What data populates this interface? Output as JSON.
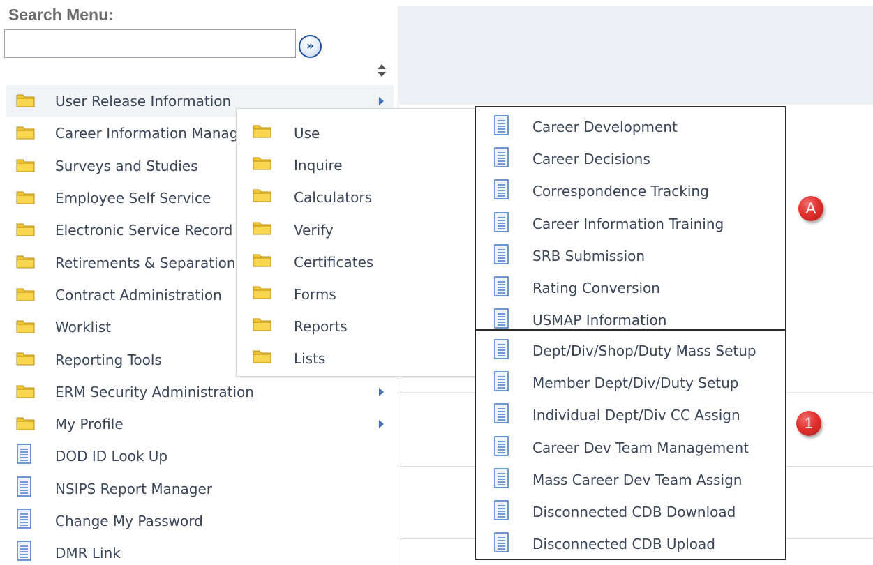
{
  "search": {
    "title": "Search Menu:",
    "value": "",
    "placeholder": "",
    "go_glyph": "»"
  },
  "menu": {
    "items": [
      {
        "label": "User Release Information",
        "type": "folder",
        "has_submenu": true,
        "active": true
      },
      {
        "label": "Career Information Management",
        "type": "folder"
      },
      {
        "label": "Surveys and Studies",
        "type": "folder"
      },
      {
        "label": "Employee Self Service",
        "type": "folder"
      },
      {
        "label": "Electronic Service Record",
        "type": "folder"
      },
      {
        "label": "Retirements & Separations",
        "type": "folder"
      },
      {
        "label": "Contract Administration",
        "type": "folder"
      },
      {
        "label": "Worklist",
        "type": "folder"
      },
      {
        "label": "Reporting Tools",
        "type": "folder"
      },
      {
        "label": "ERM Security Administration",
        "type": "folder",
        "has_submenu": true
      },
      {
        "label": "My Profile",
        "type": "folder",
        "has_submenu": true
      },
      {
        "label": "DOD ID Look Up",
        "type": "page"
      },
      {
        "label": "NSIPS Report Manager",
        "type": "page"
      },
      {
        "label": "Change My Password",
        "type": "page"
      },
      {
        "label": "DMR Link",
        "type": "page"
      }
    ]
  },
  "submenu": {
    "items": [
      {
        "label": "Use"
      },
      {
        "label": "Inquire"
      },
      {
        "label": "Calculators"
      },
      {
        "label": "Verify"
      },
      {
        "label": "Certificates"
      },
      {
        "label": "Forms"
      },
      {
        "label": "Reports"
      },
      {
        "label": "Lists"
      }
    ]
  },
  "group_a": {
    "callout": "A",
    "items": [
      {
        "label": "Career Development"
      },
      {
        "label": "Career Decisions"
      },
      {
        "label": "Correspondence Tracking"
      },
      {
        "label": "Career Information Training"
      },
      {
        "label": "SRB Submission"
      },
      {
        "label": "Rating Conversion"
      },
      {
        "label": "USMAP Information"
      }
    ]
  },
  "group_1": {
    "callout": "1",
    "items": [
      {
        "label": "Dept/Div/Shop/Duty Mass Setup"
      },
      {
        "label": "Member Dept/Div/Duty Setup"
      },
      {
        "label": "Individual Dept/Div CC Assign"
      },
      {
        "label": "Career Dev Team Management"
      },
      {
        "label": "Mass Career Dev Team Assign"
      },
      {
        "label": "Disconnected CDB Download"
      },
      {
        "label": "Disconnected CDB Upload"
      }
    ]
  },
  "colors": {
    "folder": "#f2c530",
    "page_icon": "#4a7fc9",
    "callout": "#e0322f"
  }
}
